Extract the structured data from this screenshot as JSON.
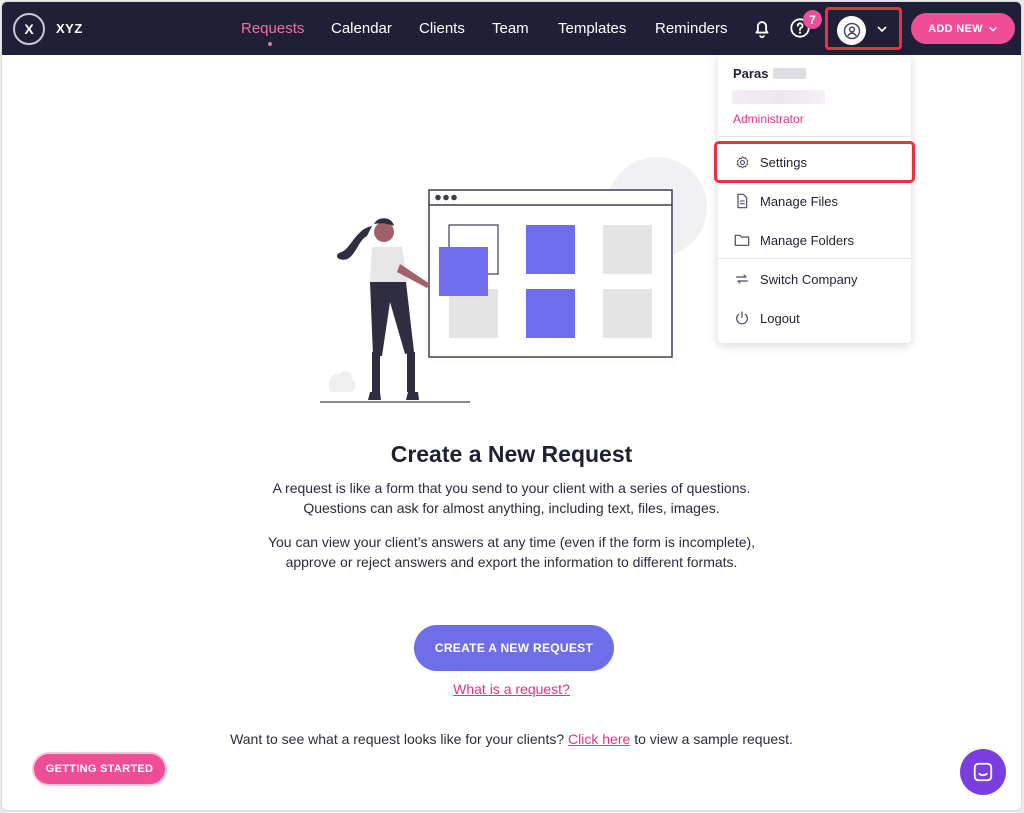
{
  "app": {
    "logo_letter": "X",
    "name": "XYZ"
  },
  "nav": {
    "items": [
      {
        "label": "Requests",
        "active": true
      },
      {
        "label": "Calendar"
      },
      {
        "label": "Clients"
      },
      {
        "label": "Team"
      },
      {
        "label": "Templates"
      },
      {
        "label": "Reminders"
      }
    ],
    "help_badge_count": "7",
    "add_new_label": "ADD NEW"
  },
  "user_menu": {
    "name": "Paras",
    "role": "Administrator",
    "items": [
      {
        "label": "Settings",
        "icon": "gear-icon",
        "highlighted": true
      },
      {
        "label": "Manage Files",
        "icon": "file-icon"
      },
      {
        "label": "Manage Folders",
        "icon": "folder-icon"
      },
      {
        "label": "Switch Company",
        "icon": "switch-icon"
      },
      {
        "label": "Logout",
        "icon": "power-icon"
      }
    ]
  },
  "main": {
    "title": "Create a New Request",
    "para1_line1": "A request is like a form that you send to your client with a series of questions.",
    "para1_line2": "Questions can ask for almost anything, including text, files, images.",
    "para2_line1": "You can view your client’s answers at any time (even if the form is incomplete),",
    "para2_line2": "approve or reject answers and export the information to different formats.",
    "cta_label": "CREATE A NEW REQUEST",
    "what_link": "What is a request?",
    "sample_prefix": "Want to see what a request looks like for your clients?",
    "sample_link": "Click here",
    "sample_suffix": "to view a sample request."
  },
  "footer": {
    "getting_started_label": "GETTING STARTED"
  },
  "colors": {
    "nav_bg": "#1f2038",
    "accent_pink": "#ef4d97",
    "accent_purple": "#6e6ee8",
    "highlight_red": "#e8323f"
  }
}
